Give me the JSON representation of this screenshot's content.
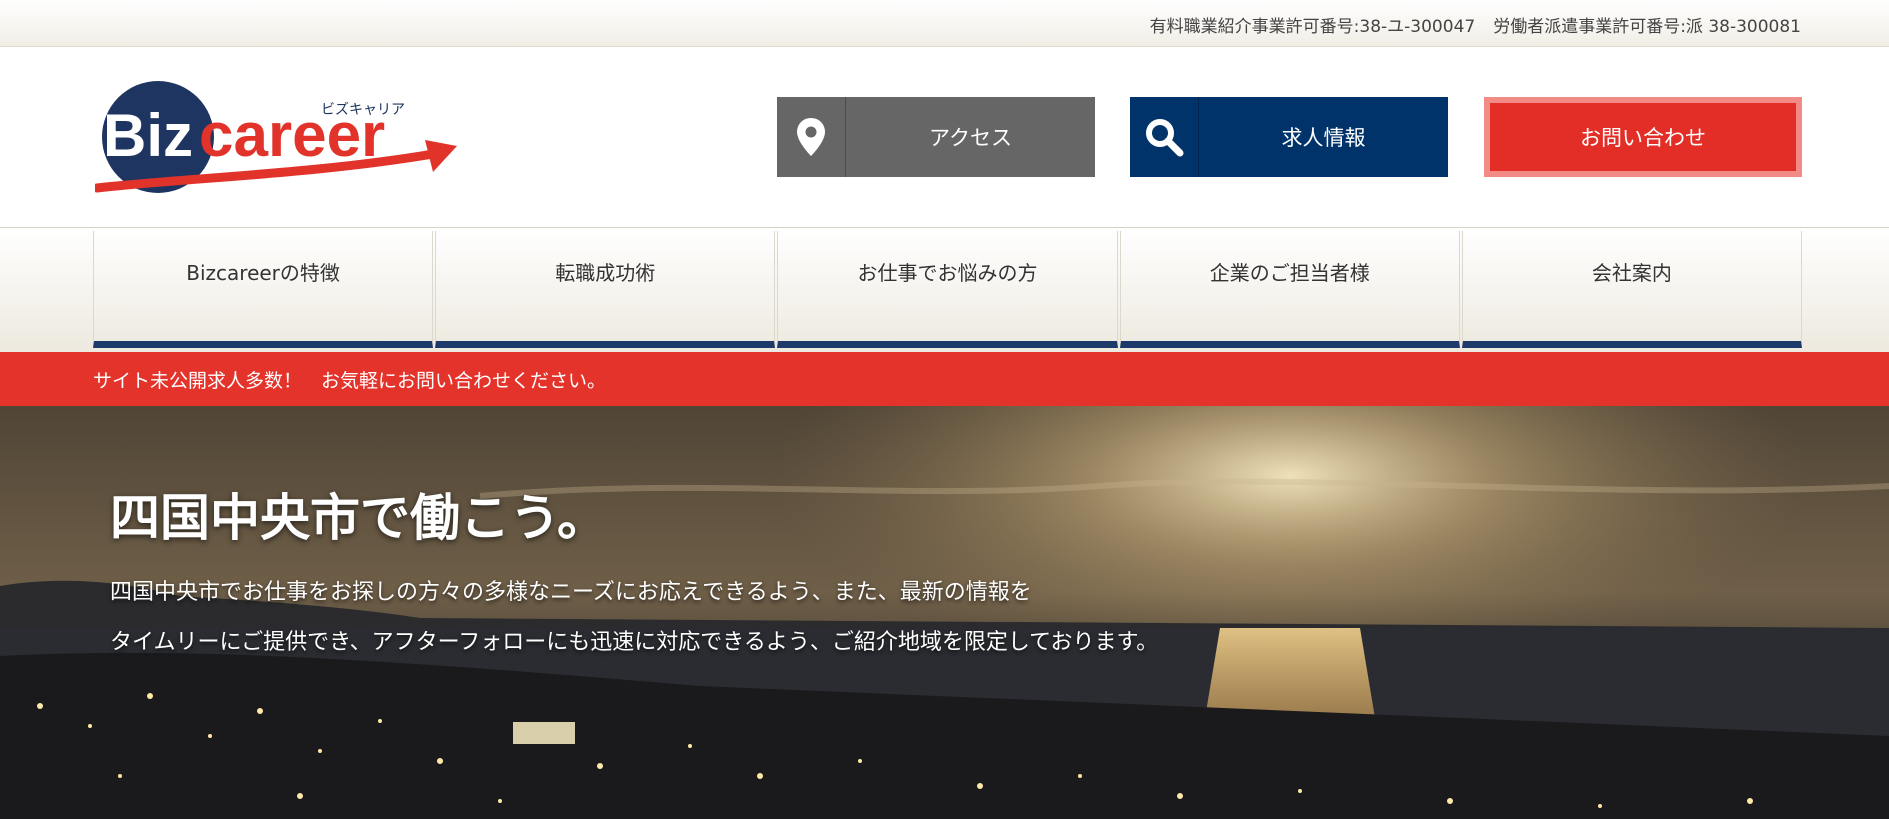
{
  "topbar": {
    "license_placement": "有料職業紹介事業許可番号:38-ユ-300047",
    "license_dispatch": "労働者派遣事業許可番号:派 38-300081"
  },
  "header": {
    "logo_brand": "Bizcareer",
    "logo_kana": "ビズキャリア",
    "buttons": {
      "access": {
        "label": "アクセス",
        "icon": "map-pin-icon"
      },
      "jobs": {
        "label": "求人情報",
        "icon": "search-icon"
      },
      "contact": {
        "label": "お問い合わせ"
      }
    }
  },
  "nav": {
    "items": [
      {
        "label": "Bizcareerの特徴"
      },
      {
        "label": "転職成功術"
      },
      {
        "label": "お仕事でお悩みの方"
      },
      {
        "label": "企業のご担当者様"
      },
      {
        "label": "会社案内"
      }
    ]
  },
  "notice": {
    "text": "サイト未公開求人多数！　お気軽にお問い合わせください。"
  },
  "hero": {
    "title": "四国中央市で働こう。",
    "line1": "四国中央市でお仕事をお探しの方々の多様なニーズにお応えできるよう、また、最新の情報を",
    "line2": "タイムリーにご提供でき、アフターフォローにも迅速に対応できるよう、ご紹介地域を限定しております。"
  },
  "colors": {
    "accent_red": "#e4332b",
    "navy": "#00336a",
    "gray_button": "#666666"
  }
}
